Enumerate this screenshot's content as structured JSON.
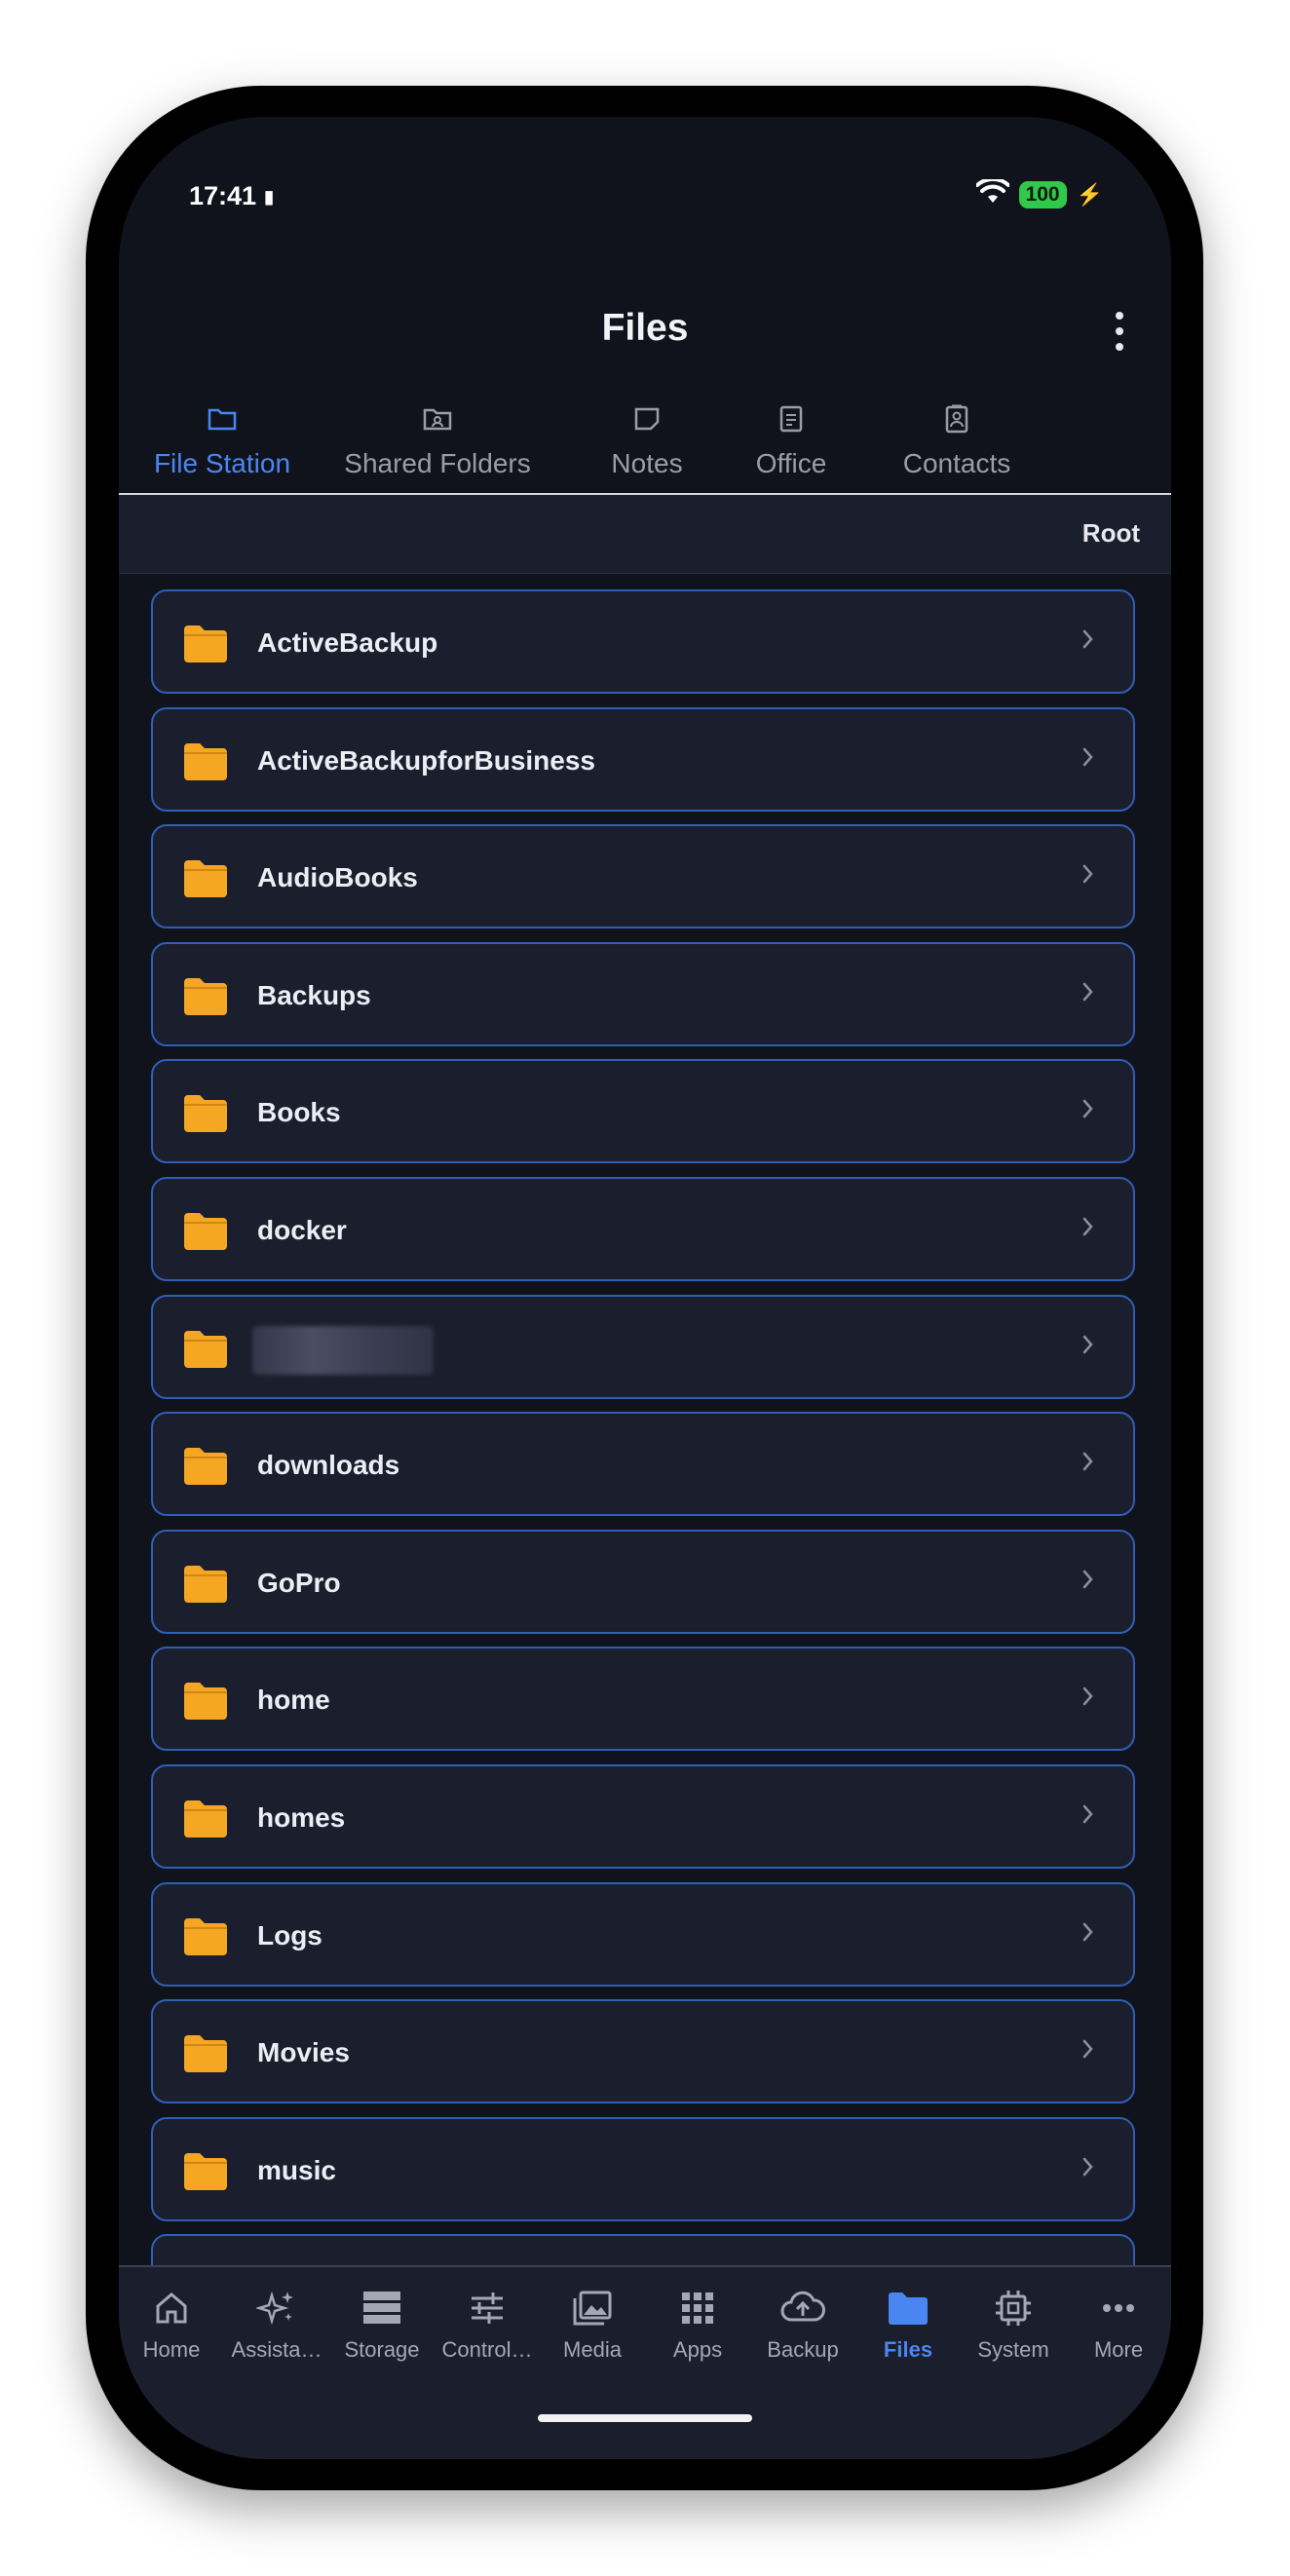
{
  "status_bar": {
    "time": "17:41",
    "battery": "100"
  },
  "header": {
    "title": "Files"
  },
  "tabs": [
    {
      "label": "File Station",
      "icon": "folder-outline-icon",
      "active": true
    },
    {
      "label": "Shared Folders",
      "icon": "shared-folder-icon",
      "active": false
    },
    {
      "label": "Notes",
      "icon": "note-icon",
      "active": false
    },
    {
      "label": "Office",
      "icon": "document-icon",
      "active": false
    },
    {
      "label": "Contacts",
      "icon": "contacts-icon",
      "active": false
    }
  ],
  "breadcrumb": {
    "current": "Root"
  },
  "folders": [
    {
      "name": "ActiveBackup"
    },
    {
      "name": "ActiveBackupforBusiness"
    },
    {
      "name": "AudioBooks"
    },
    {
      "name": "Backups"
    },
    {
      "name": "Books"
    },
    {
      "name": "docker"
    },
    {
      "name": "",
      "redacted": true
    },
    {
      "name": "downloads"
    },
    {
      "name": "GoPro"
    },
    {
      "name": "home"
    },
    {
      "name": "homes"
    },
    {
      "name": "Logs"
    },
    {
      "name": "Movies"
    },
    {
      "name": "music"
    },
    {
      "name": ""
    }
  ],
  "bottom_nav": [
    {
      "label": "Home",
      "icon": "home-icon",
      "active": false
    },
    {
      "label": "Assista…",
      "icon": "sparkle-icon",
      "active": false
    },
    {
      "label": "Storage",
      "icon": "storage-icon",
      "active": false
    },
    {
      "label": "Control…",
      "icon": "sliders-icon",
      "active": false
    },
    {
      "label": "Media",
      "icon": "media-icon",
      "active": false
    },
    {
      "label": "Apps",
      "icon": "apps-grid-icon",
      "active": false
    },
    {
      "label": "Backup",
      "icon": "cloud-upload-icon",
      "active": false
    },
    {
      "label": "Files",
      "icon": "folder-icon",
      "active": true
    },
    {
      "label": "System",
      "icon": "chip-icon",
      "active": false
    },
    {
      "label": "More",
      "icon": "more-dots-icon",
      "active": false
    }
  ],
  "colors": {
    "accent": "#4a86f2",
    "folder": "#f5a623",
    "background": "#11131c",
    "row_border": "#2f5fb4"
  }
}
